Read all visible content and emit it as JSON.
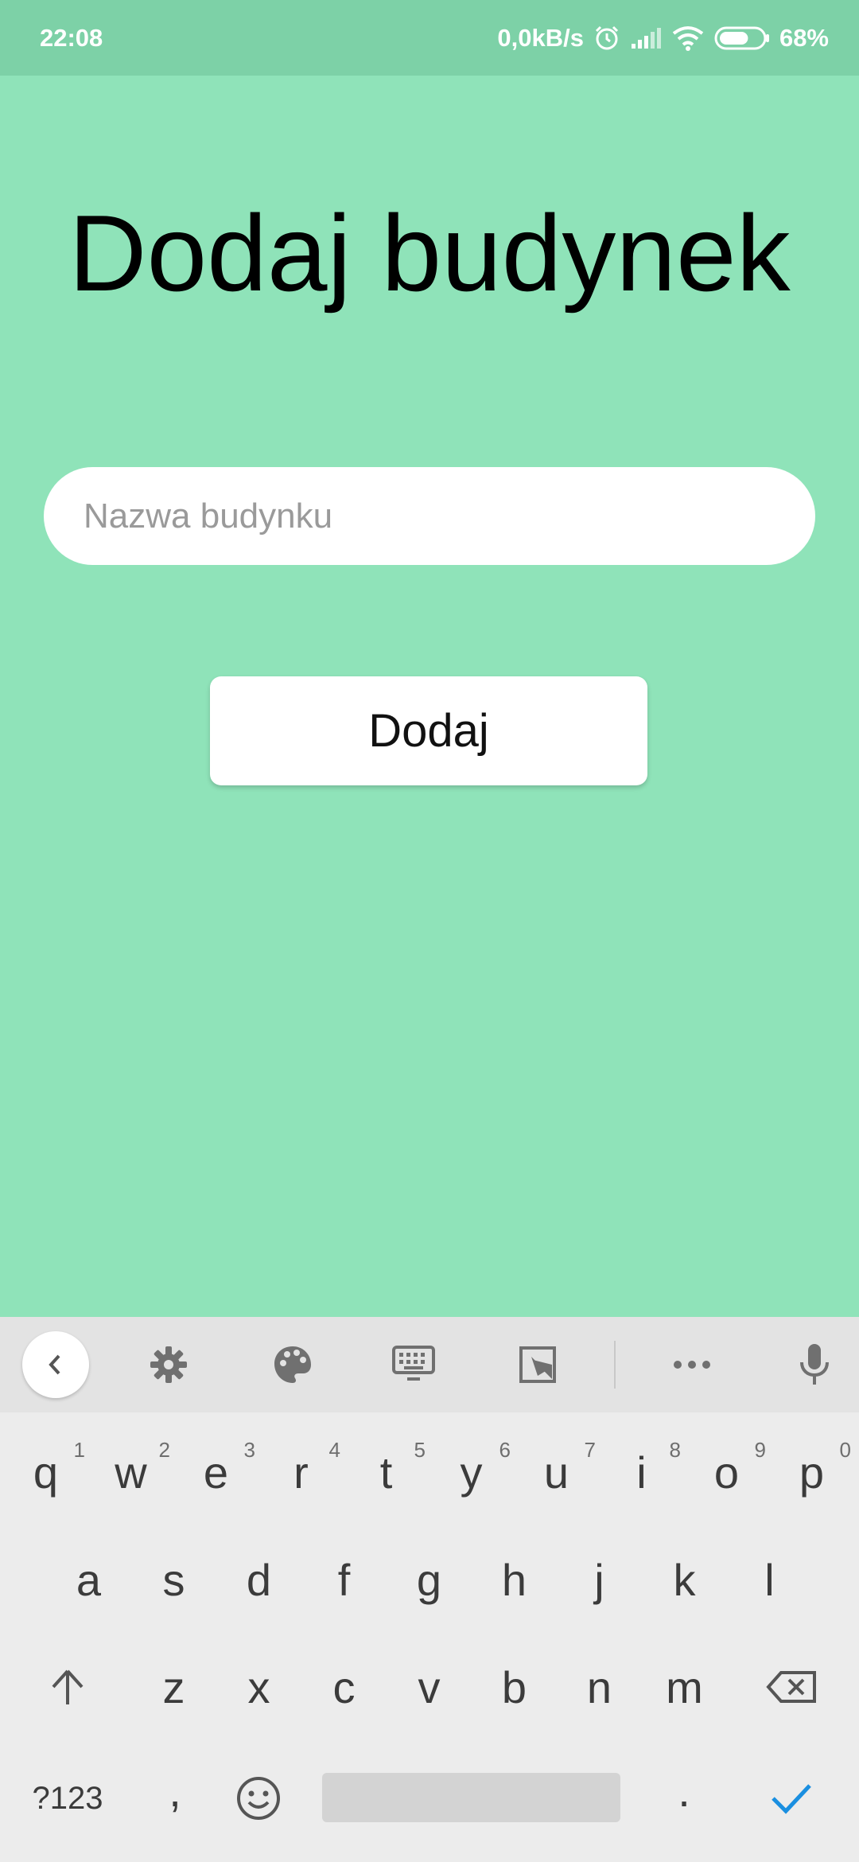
{
  "status_bar": {
    "time": "22:08",
    "net_speed": "0,0kB/s",
    "battery_pct": "68%",
    "battery_level": 0.68,
    "icons": [
      "alarm-icon",
      "signal-icon",
      "wifi-icon",
      "battery-icon"
    ]
  },
  "app": {
    "title": "Dodaj budynek",
    "name_input": {
      "placeholder": "Nazwa budynku",
      "value": ""
    },
    "add_button_label": "Dodaj",
    "background_color": "#8fe3b9"
  },
  "keyboard": {
    "toolbar_icons": [
      "chevron-left-icon",
      "gear-icon",
      "palette-icon",
      "keyboard-icon",
      "clipboard-icon",
      "more-icon",
      "microphone-icon"
    ],
    "row1": [
      {
        "key": "q",
        "hint": "1"
      },
      {
        "key": "w",
        "hint": "2"
      },
      {
        "key": "e",
        "hint": "3"
      },
      {
        "key": "r",
        "hint": "4"
      },
      {
        "key": "t",
        "hint": "5"
      },
      {
        "key": "y",
        "hint": "6"
      },
      {
        "key": "u",
        "hint": "7"
      },
      {
        "key": "i",
        "hint": "8"
      },
      {
        "key": "o",
        "hint": "9"
      },
      {
        "key": "p",
        "hint": "0"
      }
    ],
    "row2": [
      "a",
      "s",
      "d",
      "f",
      "g",
      "h",
      "j",
      "k",
      "l"
    ],
    "row3": [
      "z",
      "x",
      "c",
      "v",
      "b",
      "n",
      "m"
    ],
    "symbols_key": "?123",
    "comma_key": ",",
    "period_key": ".",
    "accent_color": "#1a8fe0"
  }
}
